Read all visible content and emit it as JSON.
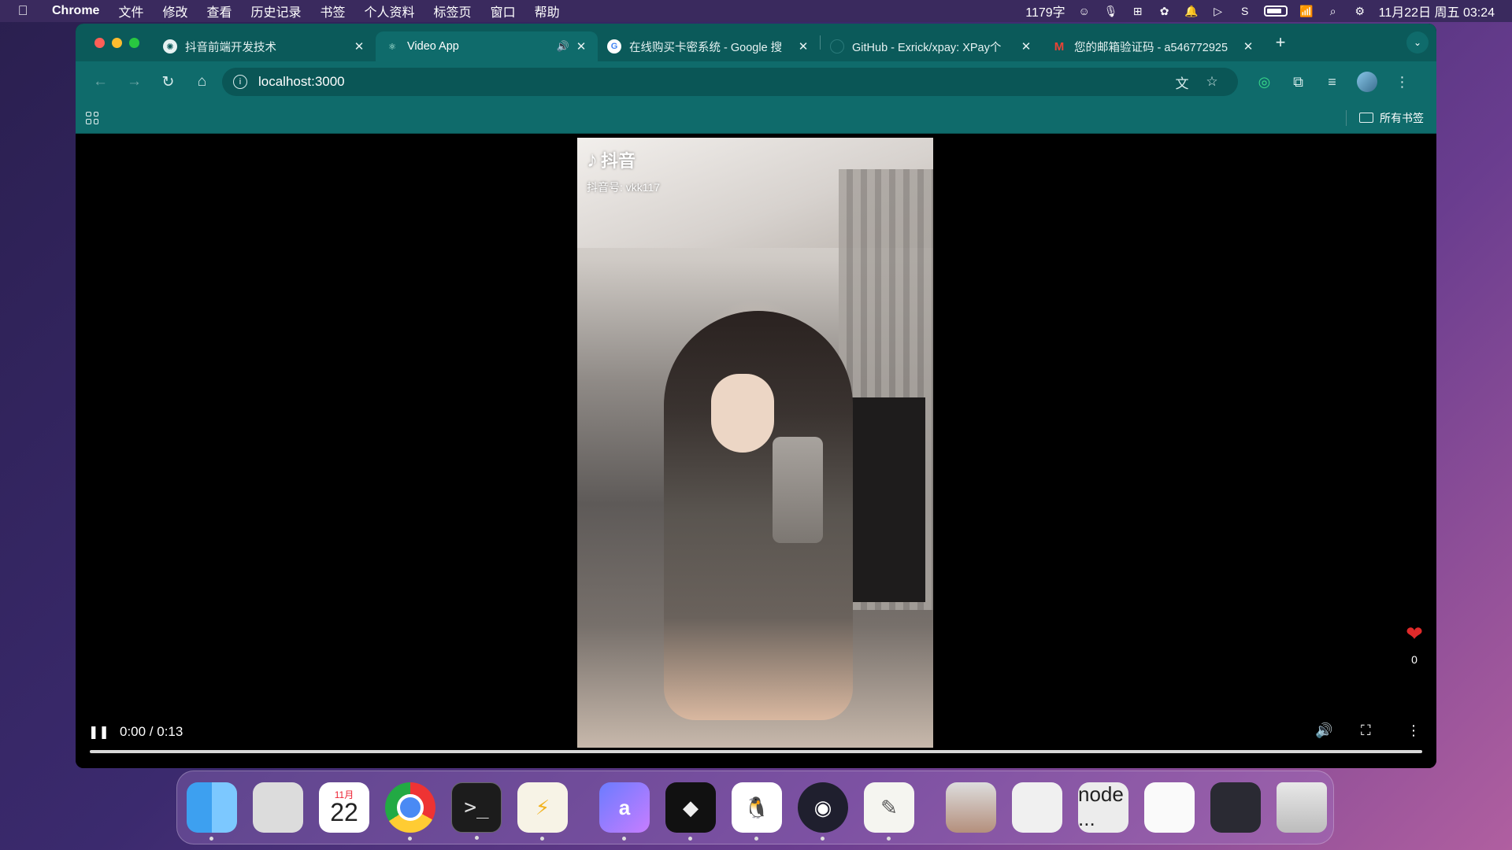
{
  "menubar": {
    "app": "Chrome",
    "items": [
      "文件",
      "修改",
      "查看",
      "历史记录",
      "书签",
      "个人资料",
      "标签页",
      "窗口",
      "帮助"
    ],
    "word_count": "1179字",
    "datetime": "11月22日 周五 03:24"
  },
  "tabs": [
    {
      "title": "抖音前端开发技术",
      "icon": "chatgpt-icon",
      "active": false
    },
    {
      "title": "Video App",
      "icon": "react-icon",
      "active": true,
      "audio": true
    },
    {
      "title": "在线购买卡密系统 - Google 搜",
      "icon": "google-icon",
      "active": false
    },
    {
      "title": "GitHub - Exrick/xpay: XPay个",
      "icon": "github-icon",
      "active": false
    },
    {
      "title": "您的邮箱验证码 - a546772925",
      "icon": "gmail-icon",
      "active": false
    }
  ],
  "toolbar": {
    "url": "localhost:3000"
  },
  "bookmarks": {
    "all_label": "所有书签"
  },
  "video": {
    "watermark": "抖音",
    "uid": "抖音号: vkk117",
    "time": "0:00 / 0:13",
    "progress": 0.0,
    "likes": "0"
  },
  "dock": {
    "calendar_month": "11月",
    "calendar_day": "22",
    "node_label": "node ..."
  },
  "colors": {
    "tab_bar": "#0b5a5a",
    "toolbar": "#0f6b6b",
    "heart": "#e02a2a"
  }
}
